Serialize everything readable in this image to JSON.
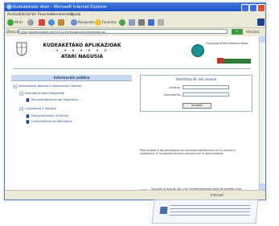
{
  "window": {
    "title": "Kudeaketako Atari - Microsoft Internet Explorer"
  },
  "menubar": {
    "items": [
      "Archivo",
      "Edición",
      "Ver",
      "Favoritos",
      "Herramientas",
      "Ayuda"
    ]
  },
  "toolbar": {
    "back_label": "Atrás",
    "search_label": "Búsqueda",
    "favorites_label": "Favoritos"
  },
  "address": {
    "label": "Dirección",
    "url": "http://www.euskadi.net/r33-2220/es/aplicaciones/index.jsp",
    "go_label": "Ir",
    "links_label": "Vínculos"
  },
  "header": {
    "title_line1": "KUDEAKETAKO APLIKAZIOAK",
    "dots": "• • • • • • •",
    "title_line2": "ATARI NAGUSIA",
    "logo_text": "Eusko Jaurlaritza Gobierno Vasco"
  },
  "info_panel": {
    "heading": "Información pública",
    "items": [
      {
        "label": "Aplicaciones Basicas e Informacion General"
      },
      {
        "label": "Normativa sobre Seguridad"
      },
      {
        "label": "Recomendaciones de Seguridad"
      },
      {
        "label": "Consultoría y Soporte"
      },
      {
        "label": "Documentación de Ayuda"
      },
      {
        "label": "Cumplimiento de Normativa"
      }
    ]
  },
  "login": {
    "heading": "Identificación del usuario",
    "user_label": "Usuario:",
    "password_label": "Contraseña:",
    "button_label": "Aceptar"
  },
  "notes": {
    "text1": "Para acceder a las aplicaciones es necesario identificarse con su usuario y contraseña. Si no dispone de ellos contacte con el administrador.",
    "text2": "Consulte la guía de uso y las recomendaciones antes de acceder a las aplicaciones de gestión."
  },
  "status": {
    "zone": "Internet"
  }
}
